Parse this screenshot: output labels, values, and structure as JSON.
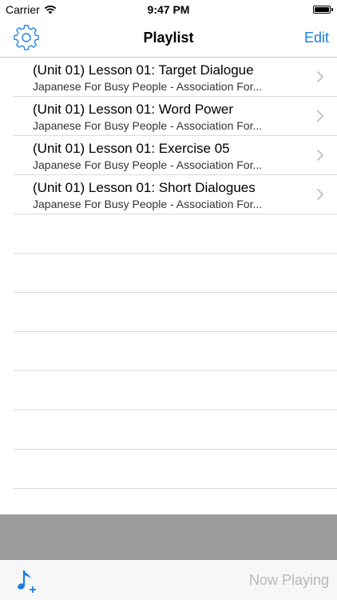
{
  "status_bar": {
    "carrier": "Carrier",
    "time": "9:47 PM",
    "battery_level": 1.0
  },
  "nav": {
    "title": "Playlist",
    "edit_label": "Edit",
    "settings_icon": "gear-icon"
  },
  "playlist": {
    "items": [
      {
        "title": "(Unit 01) Lesson 01: Target Dialogue",
        "subtitle": "Japanese For Busy People - Association For..."
      },
      {
        "title": "(Unit 01) Lesson 01: Word Power",
        "subtitle": "Japanese For Busy People - Association For..."
      },
      {
        "title": "(Unit 01) Lesson 01: Exercise 05",
        "subtitle": "Japanese For Busy People - Association For..."
      },
      {
        "title": "(Unit 01) Lesson 01: Short Dialogues",
        "subtitle": "Japanese For Busy People - Association For..."
      }
    ]
  },
  "toolbar": {
    "add_icon": "music-note-add-icon",
    "now_playing_label": "Now Playing"
  },
  "colors": {
    "accent": "#1a7ee3",
    "disabled": "#b8b8b8",
    "band": "#9c9c9c"
  }
}
